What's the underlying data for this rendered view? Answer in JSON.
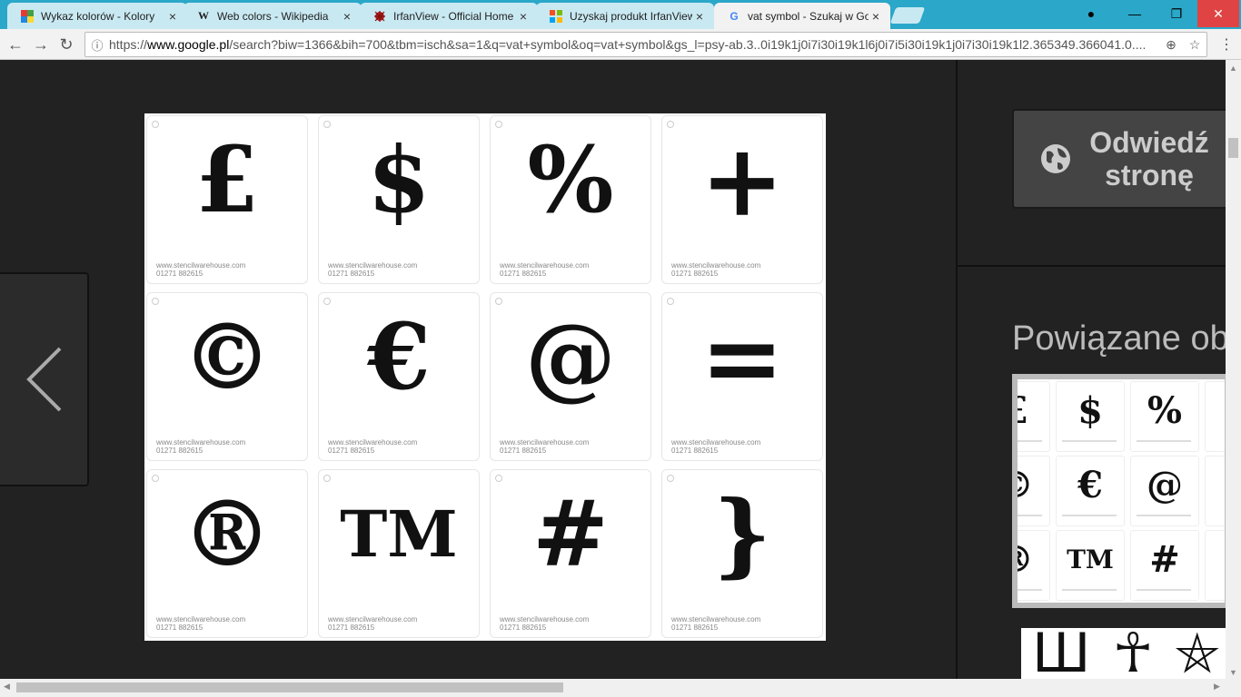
{
  "tabs": [
    {
      "title": "Wykaz kolorów - Kolory",
      "favicon": "colors-favicon",
      "close": "×"
    },
    {
      "title": "Web colors - Wikipedia",
      "favicon": "wikipedia-favicon",
      "favicon_text": "W",
      "close": "×"
    },
    {
      "title": "IrfanView - Official Home",
      "favicon": "irfanview-favicon",
      "close": "×"
    },
    {
      "title": "Uzyskaj produkt IrfanView",
      "favicon": "microsoft-favicon",
      "close": "×"
    },
    {
      "title": "vat symbol - Szukaj w Go",
      "favicon": "google-favicon",
      "favicon_text": "G",
      "close": "×",
      "active": true
    }
  ],
  "window_controls": {
    "profile": "●",
    "minimize": "—",
    "restore": "❐",
    "close": "✕"
  },
  "nav": {
    "back": "←",
    "forward": "→",
    "reload": "↻",
    "info": "ⓘ",
    "zoom": "⊕",
    "star": "☆",
    "menu": "⋮"
  },
  "url": {
    "scheme": "https://",
    "host": "www.google.pl",
    "path": "/search?biw=1366&bih=700&tbm=isch&sa=1&q=vat+symbol&oq=vat+symbol&gs_l=psy-ab.3..0i19k1j0i7i30i19k1l6j0i7i5i30i19k1j0i7i30i19k1l2.365349.366041.0...."
  },
  "image_symbols": [
    "£",
    "$",
    "%",
    "+",
    "©",
    "€",
    "@",
    "=",
    "®",
    "TM",
    "#",
    "}"
  ],
  "image_caption_line1": "www.stencilwarehouse.com",
  "image_caption_line2": "01271 882615",
  "side_panel": {
    "visit_button_line1": "Odwiedź",
    "visit_button_line2": "stronę",
    "related_title": "Powiązane ob",
    "related_symbols": [
      "£",
      "$",
      "%",
      "©",
      "€",
      "@",
      "®",
      "TM",
      "#"
    ],
    "related_symbols_2": [
      "Ш",
      "☥",
      "⛤"
    ]
  },
  "colors": {
    "tabstrip": "#2aa7c9",
    "inactive_tab": "#c9e9f2",
    "active_tab": "#f2f2f2",
    "background": "#222222"
  }
}
